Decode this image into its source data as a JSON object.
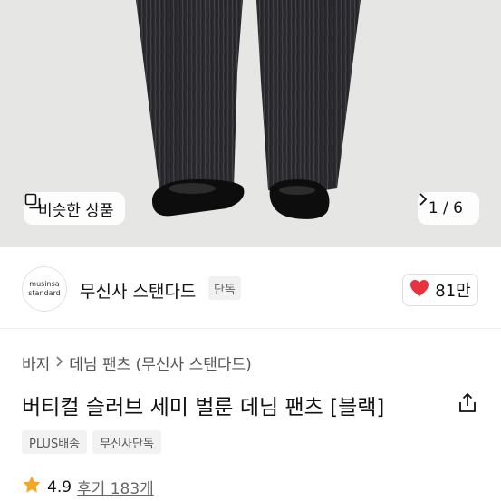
{
  "hero": {
    "similar_label": "비슷한 상품",
    "counter": "1 / 6"
  },
  "brand": {
    "logo_line1": "musinsa",
    "logo_line2": "standard",
    "name": "무신사 스탠다드",
    "badge": "단독",
    "like_count": "81만",
    "like_color": "#e8323f"
  },
  "breadcrumb": {
    "items": [
      "바지",
      "데님 팬츠 (무신사 스탠다드)"
    ]
  },
  "product": {
    "title": "버티컬 슬러브 세미 벌룬 데님 팬츠 [블랙]"
  },
  "tags": [
    "PLUS배송",
    "무신사단독"
  ],
  "rating": {
    "score": "4.9",
    "reviews": "후기 183개",
    "star_color": "#f5a623"
  }
}
